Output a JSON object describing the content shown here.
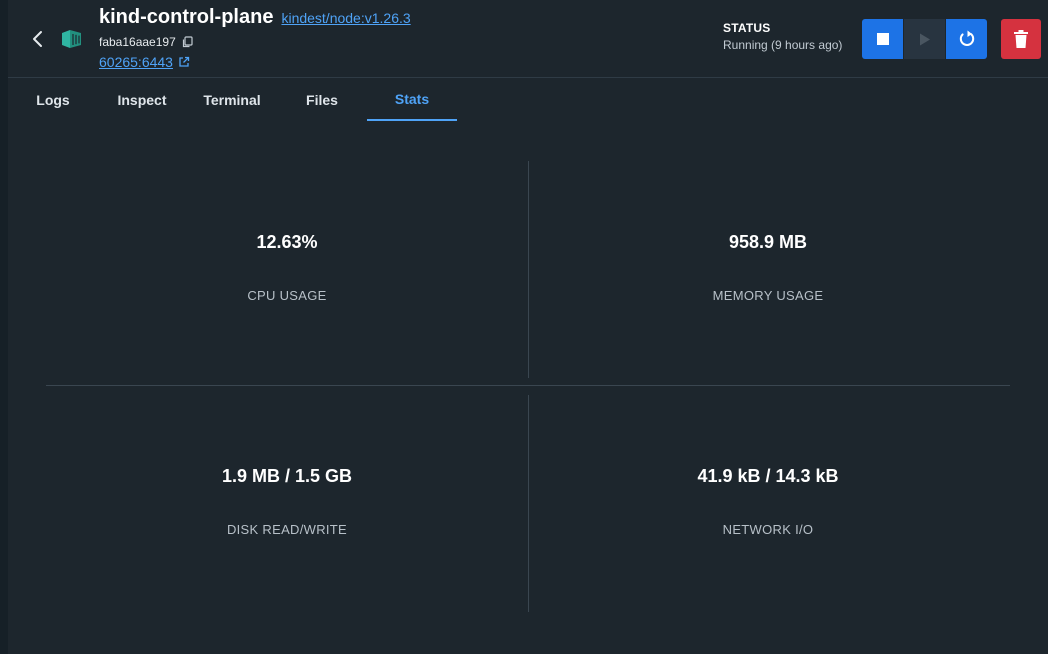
{
  "header": {
    "title": "kind-control-plane",
    "image_link": "kindest/node:v1.26.3",
    "container_id": "faba16aae197",
    "port_link": "60265:6443"
  },
  "status": {
    "label": "STATUS",
    "value": "Running (9 hours ago)"
  },
  "tabs": [
    {
      "label": "Logs",
      "active": false
    },
    {
      "label": "Inspect",
      "active": false
    },
    {
      "label": "Terminal",
      "active": false
    },
    {
      "label": "Files",
      "active": false
    },
    {
      "label": "Stats",
      "active": true
    }
  ],
  "stats": {
    "cpu": {
      "value": "12.63%",
      "label": "CPU USAGE"
    },
    "memory": {
      "value": "958.9 MB",
      "label": "MEMORY USAGE"
    },
    "disk": {
      "value": "1.9 MB / 1.5 GB",
      "label": "DISK READ/WRITE"
    },
    "network": {
      "value": "41.9 kB / 14.3 kB",
      "label": "NETWORK I/O"
    }
  },
  "colors": {
    "background": "#1d262d",
    "accent": "#4fa3f7",
    "primary_button": "#1d73e6",
    "danger_button": "#d5323f",
    "container_icon": "#2fb5a2"
  },
  "icons": {
    "back": "chevron-left-icon",
    "container": "container-icon",
    "copy": "copy-icon",
    "external": "external-link-icon",
    "stop": "stop-icon",
    "play": "play-icon",
    "restart": "restart-icon",
    "delete": "trash-icon"
  }
}
